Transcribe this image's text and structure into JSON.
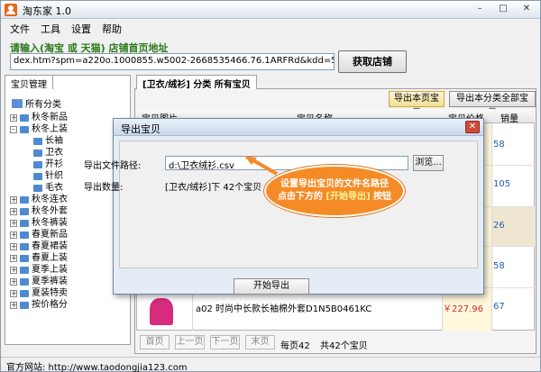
{
  "window": {
    "title": "淘东家 1.0",
    "min": "–",
    "max": "□",
    "close": "✕"
  },
  "menu": [
    "文件",
    "工具",
    "设置",
    "帮助"
  ],
  "url_bar": {
    "prompt": "请输入(淘宝 或 天猫) 店铺首页地址",
    "value": "dex.htm?spm=a220o.1000855.w5002-2668535466.76.1ARFRd&kdd=5002-26685...",
    "button": "获取店铺"
  },
  "left_panel": {
    "tab": "宝贝管理",
    "root": "所有分类",
    "nodes": [
      "秋冬新品",
      "秋冬上装",
      "长袖",
      "卫衣",
      "开衫",
      "针织",
      "毛衣",
      "秋冬连衣",
      "秋冬外套",
      "秋冬裤装",
      "春夏新品",
      "春夏裙装",
      "春夏上装",
      "夏季上装",
      "夏季裤装",
      "夏装特卖",
      "按价格分"
    ]
  },
  "main_tab": "[卫衣/绒衫] 分类 所有宝贝",
  "toolbar": {
    "export_page": "导出本页宝贝",
    "export_category": "导出本分类全部宝贝"
  },
  "grid": {
    "headers": [
      "宝贝图片",
      "宝贝名称",
      "宝贝价格",
      "销量"
    ],
    "sales": [
      "58",
      "105",
      "26",
      "58",
      "67"
    ],
    "last_row_name": "a02 时尚中长款长袖棉外套D1N5B0461KC",
    "last_row_price": "￥227.96"
  },
  "pager": {
    "first": "首页",
    "prev": "上一页",
    "next": "下一页",
    "last": "末页",
    "per_page": "每页42",
    "total": "共42个宝贝"
  },
  "status": {
    "site_label": "官方网站: http://www.taodongjia123.com"
  },
  "dialog": {
    "title": "导出宝贝",
    "close": "✕",
    "path_label": "导出文件路径:",
    "path_value": "d:\\卫衣绒衫.csv",
    "browse": "浏览...",
    "count_label": "导出数量:",
    "count_value": "[卫衣/绒衫]下 42个宝贝",
    "start": "开始导出"
  },
  "callout": {
    "line1": "设置导出宝贝的文件名路径",
    "line2_a": "点击下方的 ",
    "line2_b": "[开始导出]",
    "line2_c": " 按钮"
  },
  "colors": {
    "accent_orange": "#f58b26",
    "prompt_green": "#2d7a1a",
    "price_red": "#d42a2a"
  }
}
